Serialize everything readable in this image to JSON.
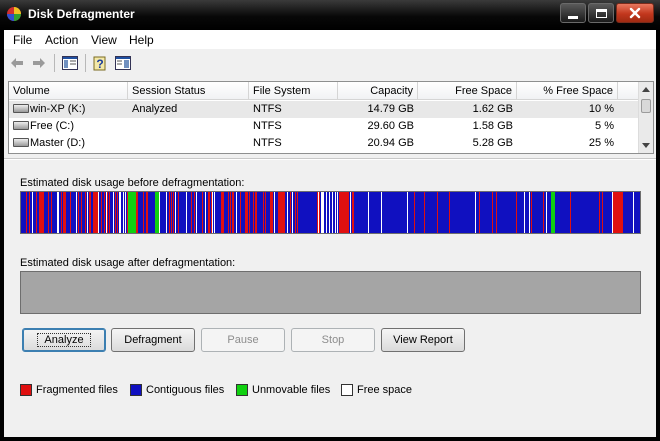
{
  "window": {
    "title": "Disk Defragmenter"
  },
  "menu": [
    "File",
    "Action",
    "View",
    "Help"
  ],
  "volumes": {
    "columns": [
      "Volume",
      "Session Status",
      "File System",
      "Capacity",
      "Free Space",
      "% Free Space"
    ],
    "rows": [
      {
        "volume": "win-XP (K:)",
        "status": "Analyzed",
        "fs": "NTFS",
        "capacity": "14.79 GB",
        "free": "1.62 GB",
        "pct": "10 %"
      },
      {
        "volume": "Free (C:)",
        "status": "",
        "fs": "NTFS",
        "capacity": "29.60 GB",
        "free": "1.58 GB",
        "pct": "5 %"
      },
      {
        "volume": "Master (D:)",
        "status": "",
        "fs": "NTFS",
        "capacity": "20.94 GB",
        "free": "5.28 GB",
        "pct": "25 %"
      }
    ]
  },
  "labels": {
    "before": "Estimated disk usage before defragmentation:",
    "after": "Estimated disk usage after defragmentation:"
  },
  "buttons": {
    "analyze": "Analyze",
    "defragment": "Defragment",
    "pause": "Pause",
    "stop": "Stop",
    "report": "View Report"
  },
  "legend": [
    {
      "label": "Fragmented files",
      "color": "#e01010"
    },
    {
      "label": "Contiguous files",
      "color": "#1010c0"
    },
    {
      "label": "Unmovable files",
      "color": "#10d010"
    },
    {
      "label": "Free space",
      "color": "#ffffff"
    }
  ],
  "colors": {
    "fragmented": "#e01010",
    "contiguous": "#1010c0",
    "unmovable": "#10d010",
    "free": "#ffffff",
    "after_bar": "#a5a5a5"
  }
}
